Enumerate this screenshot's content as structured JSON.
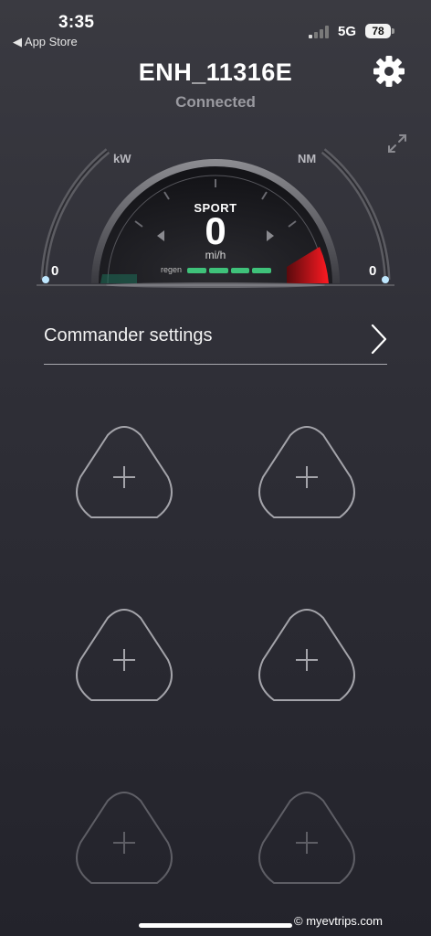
{
  "status_bar": {
    "time": "3:35",
    "back_label": "◀ App Store",
    "network": "5G",
    "battery": "78"
  },
  "header": {
    "device_name": "ENH_11316E",
    "connection_status": "Connected"
  },
  "gauge": {
    "left_unit": "kW",
    "right_unit": "NM",
    "left_value": "0",
    "right_value": "0",
    "mode": "SPORT",
    "speed": "0",
    "speed_unit": "mi/h",
    "regen_label": "regen"
  },
  "commander": {
    "label": "Commander settings"
  },
  "slots": {
    "count": 6,
    "add_symbol": "+"
  },
  "watermark": "© myevtrips.com",
  "colors": {
    "regen_green": "#3fc27a",
    "power_red": "#e0141c",
    "background": "#2f2f37"
  }
}
